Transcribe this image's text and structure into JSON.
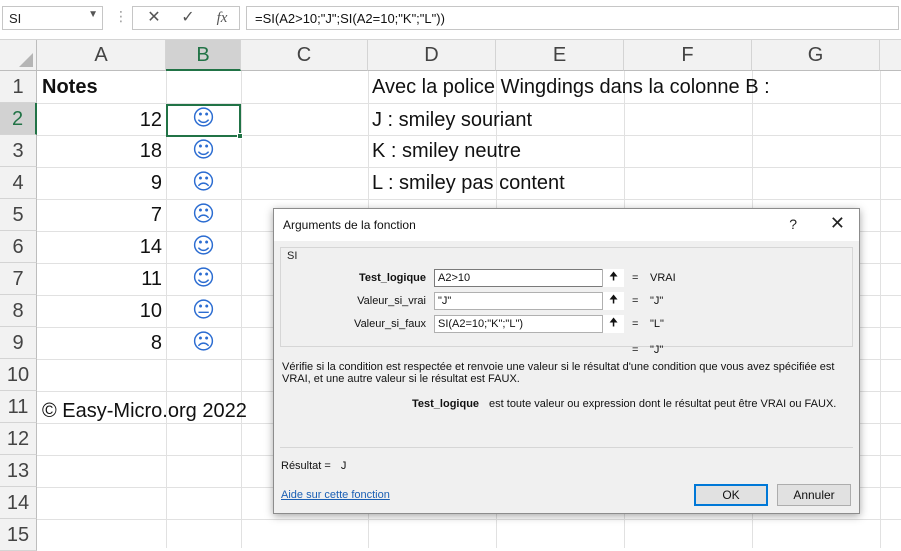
{
  "formula_bar": {
    "name_box": "SI",
    "separator": "⋮",
    "cancel_icon": "✕",
    "enter_icon": "✓",
    "fx_icon": "fx",
    "formula": "=SI(A2>10;\"J\";SI(A2=10;\"K\";\"L\"))"
  },
  "columns": [
    "A",
    "B",
    "C",
    "D",
    "E",
    "F",
    "G"
  ],
  "rows": [
    "1",
    "2",
    "3",
    "4",
    "5",
    "6",
    "7",
    "8",
    "9",
    "10",
    "11",
    "12",
    "13",
    "14",
    "15"
  ],
  "sheet": {
    "header_a1": "Notes",
    "notes": [
      "12",
      "18",
      "9",
      "7",
      "14",
      "11",
      "10",
      "8"
    ],
    "smileys": [
      "☺",
      "☺",
      "☹",
      "☹",
      "☺",
      "☺",
      "😐",
      "☹"
    ],
    "d1": "Avec la police Wingdings dans la colonne B :",
    "d2": "J : smiley souriant",
    "d3": "K : smiley neutre",
    "d4": "L : smiley pas content",
    "a11": "© Easy-Micro.org 2022"
  },
  "dialog": {
    "title": "Arguments de la fonction",
    "help_icon": "?",
    "close_icon": "✕",
    "group_label": "SI",
    "args": [
      {
        "label": "Test_logique",
        "value": "A2>10",
        "result": "VRAI"
      },
      {
        "label": "Valeur_si_vrai",
        "value": "\"J\"",
        "result": "\"J\""
      },
      {
        "label": "Valeur_si_faux",
        "value": "SI(A2=10;\"K\";\"L\")",
        "result": "\"L\""
      }
    ],
    "eq": "=",
    "collapse_icon": "🠉",
    "overall_result": "\"J\"",
    "description": "Vérifie si la condition est respectée et renvoie une valeur si le résultat d'une condition que vous avez spécifiée est VRAI, et une autre valeur si le résultat est FAUX.",
    "arg_desc_name": "Test_logique",
    "arg_desc_text": "est toute valeur ou expression dont le résultat peut être VRAI ou FAUX.",
    "result_label": "Résultat =",
    "result_value": "J",
    "help_link": "Aide sur cette fonction",
    "ok": "OK",
    "cancel": "Annuler"
  },
  "colors": {
    "excel_green": "#217346",
    "smiley_blue": "#2b6cd1",
    "link_blue": "#1a5fb4"
  }
}
